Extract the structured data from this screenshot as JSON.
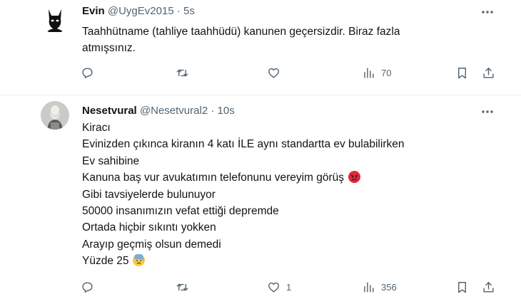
{
  "tweets": [
    {
      "name": "Evin",
      "handle": "@UygEv2015",
      "separator": "·",
      "time": "5s",
      "lines": [
        "Taahhütname (tahliye taahhüdü) kanunen geçersizdir. Biraz fazla",
        "atmışsınız."
      ],
      "stats": {
        "replies": "",
        "retweets": "",
        "likes": "",
        "views": "70"
      }
    },
    {
      "name": "Nesetvural",
      "handle": "@Nesetvural2",
      "separator": "·",
      "time": "10s",
      "lines": [
        "Kiracı",
        "Evinizden çıkınca kiranın 4 katı İLE aynı standartta ev bulabilirken",
        "Ev sahibine",
        "Kanuna baş vur avukatımın telefonunu vereyim görüş",
        "Gibi tavsiyelerde bulunuyor",
        "50000 insanımızın vefat ettiği depremde",
        "Ortada hiçbir sıkıntı yokken",
        "Arayıp geçmiş olsun demedi",
        "Yüzde 25"
      ],
      "emojis": [
        "angry-face-emoji",
        "sad-sweat-face-emoji"
      ],
      "stats": {
        "replies": "",
        "retweets": "",
        "likes": "1",
        "views": "356"
      }
    }
  ],
  "icons": [
    "more-icon",
    "reply-icon",
    "retweet-icon",
    "like-icon",
    "views-icon",
    "bookmark-icon",
    "share-icon"
  ],
  "colors": {
    "text": "#0f1419",
    "secondary": "#536471",
    "divider": "#eff3f4",
    "angry_emoji": "#e0283b",
    "sad_emoji": "#f7c940"
  }
}
